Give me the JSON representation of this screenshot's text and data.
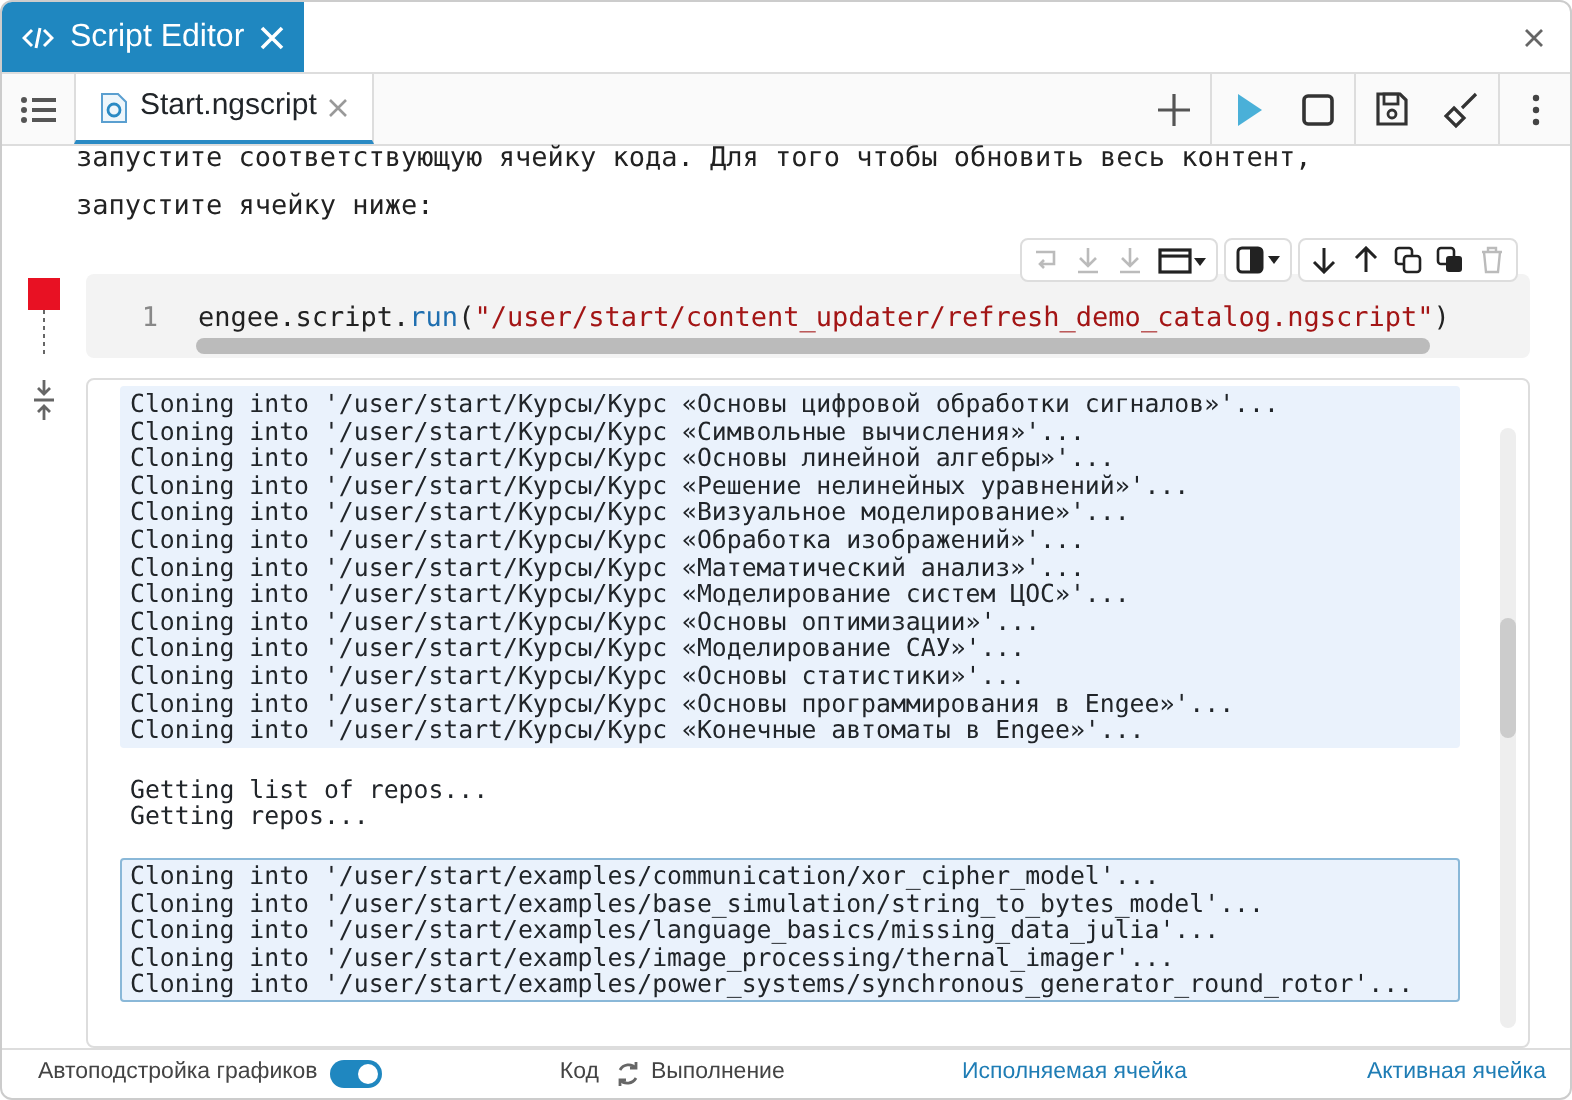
{
  "window": {
    "title": "Script Editor"
  },
  "file_tab": {
    "label": "Start.ngscript",
    "selected": true
  },
  "intro_text": [
    "запустите соответствующую ячейку кода. Для того чтобы обновить весь контент,",
    "запустите ячейку ниже:"
  ],
  "code_cell": {
    "running": true,
    "line_number": "1",
    "tokens": [
      {
        "kind": "plain",
        "text": "engee.script."
      },
      {
        "kind": "function",
        "text": "run"
      },
      {
        "kind": "plain",
        "text": "("
      },
      {
        "kind": "string",
        "text": "\"/user/start/content_updater/refresh_demo_catalog.ngscript\""
      },
      {
        "kind": "plain",
        "text": ")"
      }
    ]
  },
  "output": {
    "blocks": [
      {
        "kind": "stream",
        "selected": false,
        "lines": [
          "Cloning into '/user/start/Курсы/Курс «Основы цифровой обработки сигналов»'...",
          "Cloning into '/user/start/Курсы/Курс «Символьные вычисления»'...",
          "Cloning into '/user/start/Курсы/Курс «Основы линейной алгебры»'...",
          "Cloning into '/user/start/Курсы/Курс «Решение нелинейных уравнений»'...",
          "Cloning into '/user/start/Курсы/Курс «Визуальное моделирование»'...",
          "Cloning into '/user/start/Курсы/Курс «Обработка изображений»'...",
          "Cloning into '/user/start/Курсы/Курс «Математический анализ»'...",
          "Cloning into '/user/start/Курсы/Курс «Моделирование систем ЦОС»'...",
          "Cloning into '/user/start/Курсы/Курс «Основы оптимизации»'...",
          "Cloning into '/user/start/Курсы/Курс «Моделирование САУ»'...",
          "Cloning into '/user/start/Курсы/Курс «Основы статистики»'...",
          "Cloning into '/user/start/Курсы/Курс «Основы программирования в Engee»'...",
          "Cloning into '/user/start/Курсы/Курс «Конечные автоматы в Engee»'..."
        ]
      },
      {
        "kind": "plain",
        "selected": false,
        "lines": [
          "Getting list of repos...",
          "Getting repos..."
        ]
      },
      {
        "kind": "stream",
        "selected": true,
        "lines": [
          "Cloning into '/user/start/examples/communication/xor_cipher_model'...",
          "Cloning into '/user/start/examples/base_simulation/string_to_bytes_model'...",
          "Cloning into '/user/start/examples/language_basics/missing_data_julia'...",
          "Cloning into '/user/start/examples/image_processing/thernal_imager'...",
          "Cloning into '/user/start/examples/power_systems/synchronous_generator_round_rotor'..."
        ]
      }
    ]
  },
  "status_bar": {
    "autoscale_label": "Автоподстройка графиков",
    "autoscale_on": true,
    "code_label": "Код",
    "exec_label": "Выполнение",
    "executed_cell": "Исполняемая ячейка",
    "active_cell": "Активная ячейка"
  }
}
